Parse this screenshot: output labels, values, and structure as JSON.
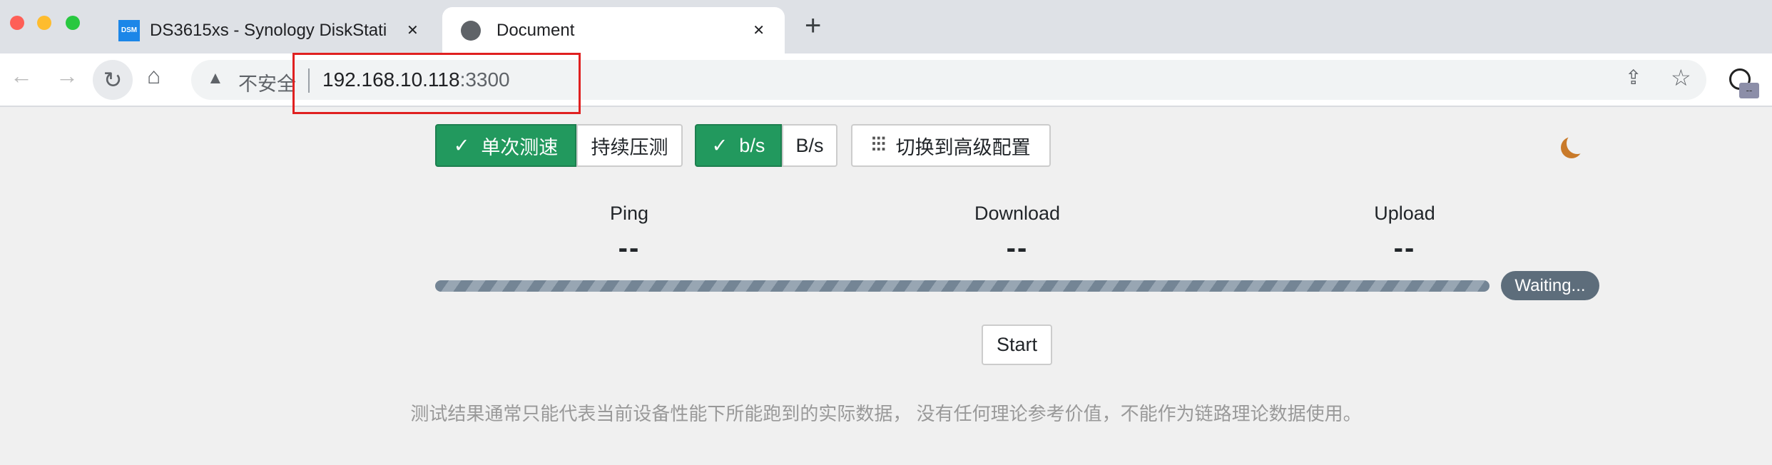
{
  "browser": {
    "tabs": [
      {
        "label": "DS3615xs - Synology DiskStati",
        "icon": "dsm-icon",
        "icon_text": "DSM"
      },
      {
        "label": "Document",
        "icon": "globe-icon"
      }
    ],
    "close_glyph": "✕",
    "new_tab_glyph": "+",
    "security_label": "不安全",
    "url_host": "192.168.10.118",
    "url_port": ":3300",
    "extension_badge": "--"
  },
  "controls": {
    "mode_single": "单次测速",
    "mode_continuous": "持续压测",
    "unit_bits": "b/s",
    "unit_bytes": "B/s",
    "advanced": "切换到高级配置",
    "check": "✓"
  },
  "metrics": [
    {
      "label": "Ping",
      "value": "--"
    },
    {
      "label": "Download",
      "value": "--"
    },
    {
      "label": "Upload",
      "value": "--"
    }
  ],
  "progress": {
    "status": "Waiting...",
    "percent": 0
  },
  "start_label": "Start",
  "footer_note": "测试结果通常只能代表当前设备性能下所能跑到的实际数据， 没有任何理论参考价值，不能作为链路理论数据使用。",
  "colors": {
    "accent": "#22995e",
    "moon": "#c97a2a",
    "highlight": "#e02020"
  }
}
